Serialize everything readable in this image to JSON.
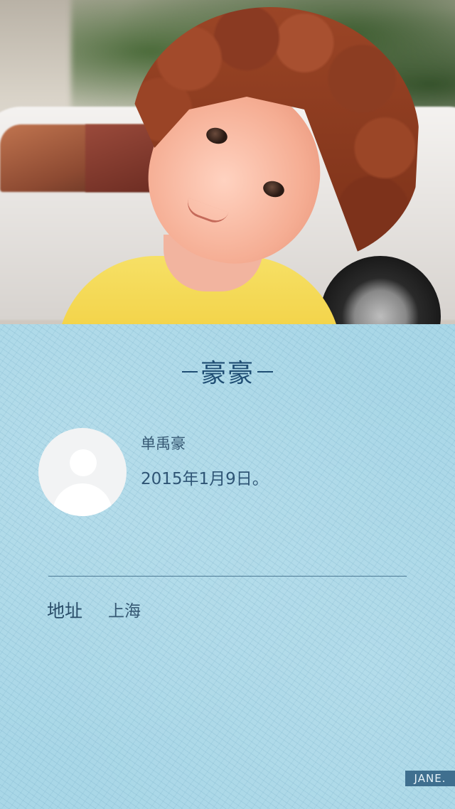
{
  "profile": {
    "title": "豪豪",
    "name": "单禹豪",
    "birthday": "2015年1月9日。"
  },
  "address": {
    "label": "地址",
    "value": "上海"
  },
  "footer": {
    "brand": "JANE."
  },
  "colors": {
    "card_bg": "#a9d7e7",
    "title": "#1f4d73",
    "text": "#365873",
    "tag_bg": "#3f6f8f"
  }
}
